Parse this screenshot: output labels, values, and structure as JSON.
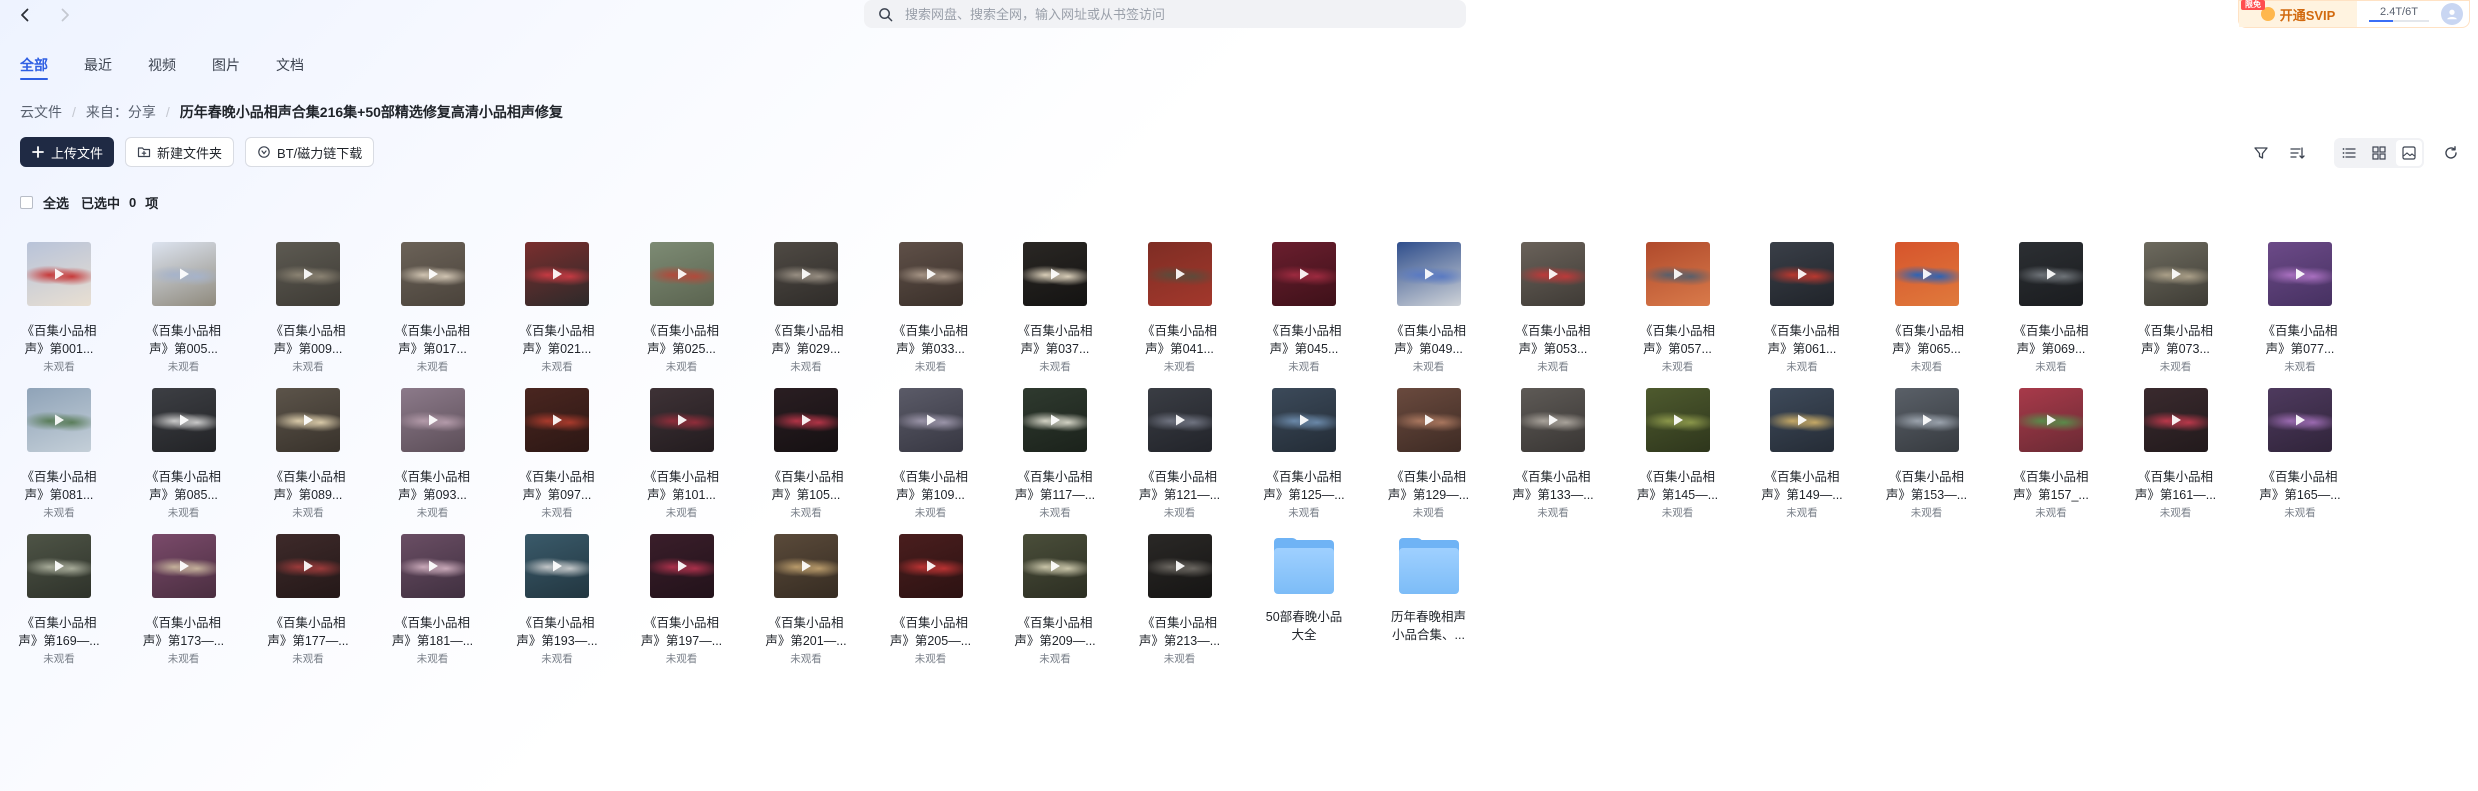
{
  "search": {
    "placeholder": "搜索网盘、搜索全网，输入网址或从书签访问"
  },
  "vip": {
    "badge": "限免",
    "label": "开通SVIP",
    "storage": "2.4T/6T",
    "storage_fraction": 0.4
  },
  "tabs": [
    {
      "label": "全部",
      "active": true
    },
    {
      "label": "最近",
      "active": false
    },
    {
      "label": "视频",
      "active": false
    },
    {
      "label": "图片",
      "active": false
    },
    {
      "label": "文档",
      "active": false
    }
  ],
  "breadcrumb": {
    "root": "云文件",
    "source": "来自：分享",
    "current": "历年春晚小品相声合集216集+50部精选修复高清小品相声修复"
  },
  "toolbar": {
    "upload": "上传文件",
    "new_folder": "新建文件夹",
    "bt_download": "BT/磁力链下载"
  },
  "selection": {
    "select_all": "全选",
    "selected_prefix": "已选中",
    "count": "0",
    "unit": "项"
  },
  "items": [
    {
      "title": "《百集小品相\n声》第001...",
      "status": "未观看",
      "type": "video",
      "colors": [
        "#b8c3d9",
        "#c73a3a",
        "#e8dfd2"
      ]
    },
    {
      "title": "《百集小品相\n声》第005...",
      "status": "未观看",
      "type": "video",
      "colors": [
        "#dce3ef",
        "#a6b3ca",
        "#8f8a7d"
      ]
    },
    {
      "title": "《百集小品相\n声》第009...",
      "status": "未观看",
      "type": "video",
      "colors": [
        "#5d5a52",
        "#8a8272",
        "#3e3b35"
      ]
    },
    {
      "title": "《百集小品相\n声》第017...",
      "status": "未观看",
      "type": "video",
      "colors": [
        "#6b6258",
        "#cfc3b1",
        "#4a433b"
      ]
    },
    {
      "title": "《百集小品相\n声》第021...",
      "status": "未观看",
      "type": "video",
      "colors": [
        "#7a2e2e",
        "#c43a42",
        "#2d2a2a"
      ]
    },
    {
      "title": "《百集小品相\n声》第025...",
      "status": "未观看",
      "type": "video",
      "colors": [
        "#7d8b74",
        "#b14a3b",
        "#5b6450"
      ]
    },
    {
      "title": "《百集小品相\n声》第029...",
      "status": "未观看",
      "type": "video",
      "colors": [
        "#4f4a44",
        "#978e82",
        "#2f2c29"
      ]
    },
    {
      "title": "《百集小品相\n声》第033...",
      "status": "未观看",
      "type": "video",
      "colors": [
        "#5f5048",
        "#a49384",
        "#3a302a"
      ]
    },
    {
      "title": "《百集小品相\n声》第037...",
      "status": "未观看",
      "type": "video",
      "colors": [
        "#2a2724",
        "#d8cdb8",
        "#141312"
      ]
    },
    {
      "title": "《百集小品相\n声》第041...",
      "status": "未观看",
      "type": "video",
      "colors": [
        "#7e2d24",
        "#5e4a3a",
        "#a3382c"
      ]
    },
    {
      "title": "《百集小品相\n声》第045...",
      "status": "未观看",
      "type": "video",
      "colors": [
        "#6a1e2e",
        "#9c2a3f",
        "#3e1119"
      ]
    },
    {
      "title": "《百集小品相\n声》第049...",
      "status": "未观看",
      "type": "video",
      "colors": [
        "#2f4e8c",
        "#5a7ac2",
        "#cfd3d8"
      ]
    },
    {
      "title": "《百集小品相\n声》第053...",
      "status": "未观看",
      "type": "video",
      "colors": [
        "#6a625a",
        "#bb3a3a",
        "#3f3b36"
      ]
    },
    {
      "title": "《百集小品相\n声》第057...",
      "status": "未观看",
      "type": "video",
      "colors": [
        "#b04a2c",
        "#5a5f6a",
        "#d97a4a"
      ]
    },
    {
      "title": "《百集小品相\n声》第061...",
      "status": "未观看",
      "type": "video",
      "colors": [
        "#3a3f48",
        "#b8382f",
        "#20242a"
      ]
    },
    {
      "title": "《百集小品相\n声》第065...",
      "status": "未观看",
      "type": "video",
      "colors": [
        "#d6542c",
        "#2f63b3",
        "#e07a3c"
      ]
    },
    {
      "title": "《百集小品相\n声》第069...",
      "status": "未观看",
      "type": "video",
      "colors": [
        "#2c2f33",
        "#6e7378",
        "#1a1c1f"
      ]
    },
    {
      "title": "《百集小品相\n声》第073...",
      "status": "未观看",
      "type": "video",
      "colors": [
        "#6d6a5e",
        "#aa9f88",
        "#3e3c35"
      ]
    },
    {
      "title": "《百集小品相\n声》第077...",
      "status": "未观看",
      "type": "video",
      "colors": [
        "#6c4a88",
        "#a86fbf",
        "#463161"
      ]
    },
    {
      "title": "《百集小品相\n声》第081...",
      "status": "未观看",
      "type": "video",
      "colors": [
        "#8fa3b8",
        "#5a7d5a",
        "#c4cfd8"
      ]
    },
    {
      "title": "《百集小品相\n声》第085...",
      "status": "未观看",
      "type": "video",
      "colors": [
        "#3d3f44",
        "#c9c9c9",
        "#222326"
      ]
    },
    {
      "title": "《百集小品相\n声》第089...",
      "status": "未观看",
      "type": "video",
      "colors": [
        "#5c544a",
        "#d8c9a8",
        "#38322b"
      ]
    },
    {
      "title": "《百集小品相\n声》第093...",
      "status": "未观看",
      "type": "video",
      "colors": [
        "#8c7a8a",
        "#b39aa9",
        "#5c4e58"
      ]
    },
    {
      "title": "《百集小品相\n声》第097...",
      "status": "未观看",
      "type": "video",
      "colors": [
        "#4a2620",
        "#a83a2c",
        "#2c1714"
      ]
    },
    {
      "title": "《百集小品相\n声》第101...",
      "status": "未观看",
      "type": "video",
      "colors": [
        "#3e3236",
        "#8f2d3a",
        "#231c1f"
      ]
    },
    {
      "title": "《百集小品相\n声》第105...",
      "status": "未观看",
      "type": "video",
      "colors": [
        "#2a1e22",
        "#b03446",
        "#151012"
      ]
    },
    {
      "title": "《百集小品相\n声》第109...",
      "status": "未观看",
      "type": "video",
      "colors": [
        "#5b5b68",
        "#9a94a8",
        "#373742"
      ]
    },
    {
      "title": "《百集小品相\n声》第117—...",
      "status": "未观看",
      "type": "video",
      "colors": [
        "#2f3a2f",
        "#d2d2c4",
        "#1b221b"
      ]
    },
    {
      "title": "《百集小品相\n声》第121—...",
      "status": "未观看",
      "type": "video",
      "colors": [
        "#3a3d44",
        "#6f7380",
        "#22242a"
      ]
    },
    {
      "title": "《百集小品相\n声》第125—...",
      "status": "未观看",
      "type": "video",
      "colors": [
        "#3c4a5a",
        "#6a88a8",
        "#232c36"
      ]
    },
    {
      "title": "《百集小品相\n声》第129—...",
      "status": "未观看",
      "type": "video",
      "colors": [
        "#6a4a3e",
        "#a8765e",
        "#3e2b24"
      ]
    },
    {
      "title": "《百集小品相\n声》第133—...",
      "status": "未观看",
      "type": "video",
      "colors": [
        "#5e5a56",
        "#a8a29a",
        "#393634"
      ]
    },
    {
      "title": "《百集小品相\n声》第145—...",
      "status": "未观看",
      "type": "video",
      "colors": [
        "#4e5a2e",
        "#8a964a",
        "#2e361c"
      ]
    },
    {
      "title": "《百集小品相\n声》第149—...",
      "status": "未观看",
      "type": "video",
      "colors": [
        "#3e4a5a",
        "#c4a866",
        "#252c36"
      ]
    },
    {
      "title": "《百集小品相\n声》第153—...",
      "status": "未观看",
      "type": "video",
      "colors": [
        "#5a6068",
        "#9aa2ac",
        "#363a3f"
      ]
    },
    {
      "title": "《百集小品相\n声》第157_...",
      "status": "未观看",
      "type": "video",
      "colors": [
        "#a83a4a",
        "#5a8a4a",
        "#6a2a34"
      ]
    },
    {
      "title": "《百集小品相\n声》第161—...",
      "status": "未观看",
      "type": "video",
      "colors": [
        "#3a2a2e",
        "#b8384a",
        "#221a1c"
      ]
    },
    {
      "title": "《百集小品相\n声》第165—...",
      "status": "未观看",
      "type": "video",
      "colors": [
        "#4e3a5e",
        "#9a6ab0",
        "#30243a"
      ]
    },
    {
      "title": "《百集小品相\n声》第169—...",
      "status": "未观看",
      "type": "video",
      "colors": [
        "#4e5446",
        "#a6aa98",
        "#2e322a"
      ]
    },
    {
      "title": "《百集小品相\n声》第173—...",
      "status": "未观看",
      "type": "video",
      "colors": [
        "#7a4a6a",
        "#c4b09a",
        "#4a2e40"
      ]
    },
    {
      "title": "《百集小品相\n声》第177—...",
      "status": "未观看",
      "type": "video",
      "colors": [
        "#3e2a2a",
        "#9a3a3a",
        "#241818"
      ]
    },
    {
      "title": "《百集小品相\n声》第181—...",
      "status": "未观看",
      "type": "video",
      "colors": [
        "#6a4e64",
        "#c8a8b8",
        "#403040"
      ]
    },
    {
      "title": "《百集小品相\n声》第193—...",
      "status": "未观看",
      "type": "video",
      "colors": [
        "#3a5a6a",
        "#c2c6c8",
        "#223640"
      ]
    },
    {
      "title": "《百集小品相\n声》第197—...",
      "status": "未观看",
      "type": "video",
      "colors": [
        "#3a1e2a",
        "#a8304a",
        "#22121a"
      ]
    },
    {
      "title": "《百集小品相\n声》第201—...",
      "status": "未观看",
      "type": "video",
      "colors": [
        "#5a4a3a",
        "#b89a6a",
        "#362c22"
      ]
    },
    {
      "title": "《百集小品相\n声》第205—...",
      "status": "未观看",
      "type": "video",
      "colors": [
        "#4a1e1e",
        "#b83232",
        "#2c1212"
      ]
    },
    {
      "title": "《百集小品相\n声》第209—...",
      "status": "未观看",
      "type": "video",
      "colors": [
        "#4a4e3a",
        "#c8c4a8",
        "#2c2e22"
      ]
    },
    {
      "title": "《百集小品相\n声》第213—...",
      "status": "未观看",
      "type": "video",
      "colors": [
        "#2a2826",
        "#6a6660",
        "#161514"
      ]
    },
    {
      "title": "50部春晚小品\n大全",
      "status": "",
      "type": "folder",
      "colors": []
    },
    {
      "title": "历年春晚相声\n小品合集、...",
      "status": "",
      "type": "folder",
      "colors": []
    }
  ]
}
